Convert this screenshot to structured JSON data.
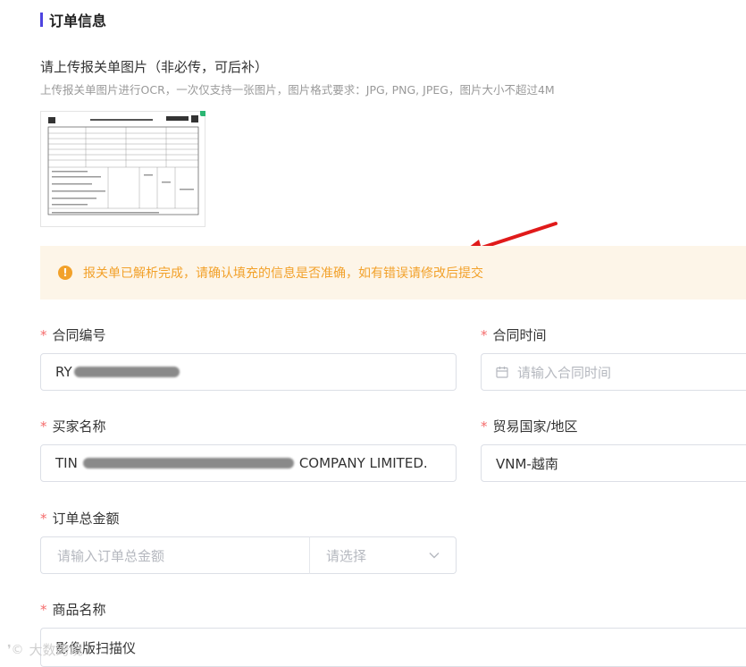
{
  "section": {
    "title": "订单信息"
  },
  "upload": {
    "title": "请上传报关单图片（非必传，可后补）",
    "hint": "上传报关单图片进行OCR，一次仅支持一张图片，图片格式要求：JPG, PNG, JPEG，图片大小不超过4M"
  },
  "alert": {
    "icon": "!",
    "text": "报关单已解析完成，请确认填充的信息是否准确，如有错误请修改后提交"
  },
  "required_mark": "*",
  "fields": {
    "contract_no": {
      "label": "合同编号",
      "value_prefix": "RY"
    },
    "contract_time": {
      "label": "合同时间",
      "placeholder": "请输入合同时间"
    },
    "buyer_name": {
      "label": "买家名称",
      "value_prefix": "TIN",
      "value_suffix": "COMPANY LIMITED."
    },
    "trade_country": {
      "label": "贸易国家/地区",
      "value": "VNM-越南"
    },
    "order_amount": {
      "label": "订单总金额",
      "placeholder": "请输入订单总金额",
      "currency_placeholder": "请选择"
    },
    "product_name": {
      "label": "商品名称",
      "value": "影像版扫描仪"
    }
  },
  "watermark": {
    "text": "大数跨境"
  },
  "colors": {
    "accent": "#4e44e0",
    "warning": "#f2a12a",
    "required": "#f56c6c",
    "alert_bg": "#fdf5e8",
    "arrow": "#e01a1a"
  }
}
